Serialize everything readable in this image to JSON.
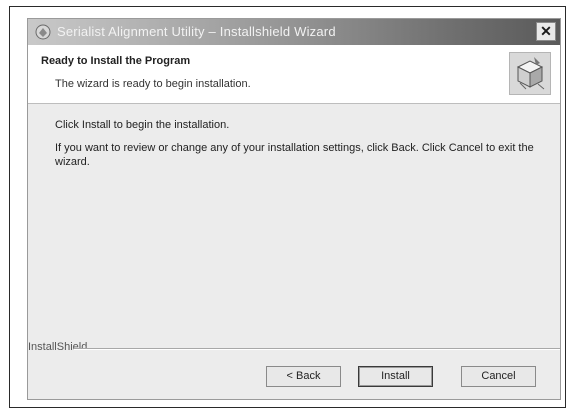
{
  "window": {
    "title": "Serialist Alignment Utility – Installshield Wizard"
  },
  "header": {
    "title": "Ready to Install the Program",
    "subtitle": "The wizard is ready to begin installation."
  },
  "body": {
    "line1": "Click Install to begin the installation.",
    "line2": "If you want to review or change any of your installation settings, click Back. Click Cancel to exit the wizard."
  },
  "footer": {
    "brand": "InstallShield"
  },
  "buttons": {
    "back": "< Back",
    "install": "Install",
    "cancel": "Cancel"
  },
  "icons": {
    "app": "installer-app-icon",
    "close": "close-icon",
    "banner": "install-box-icon"
  }
}
